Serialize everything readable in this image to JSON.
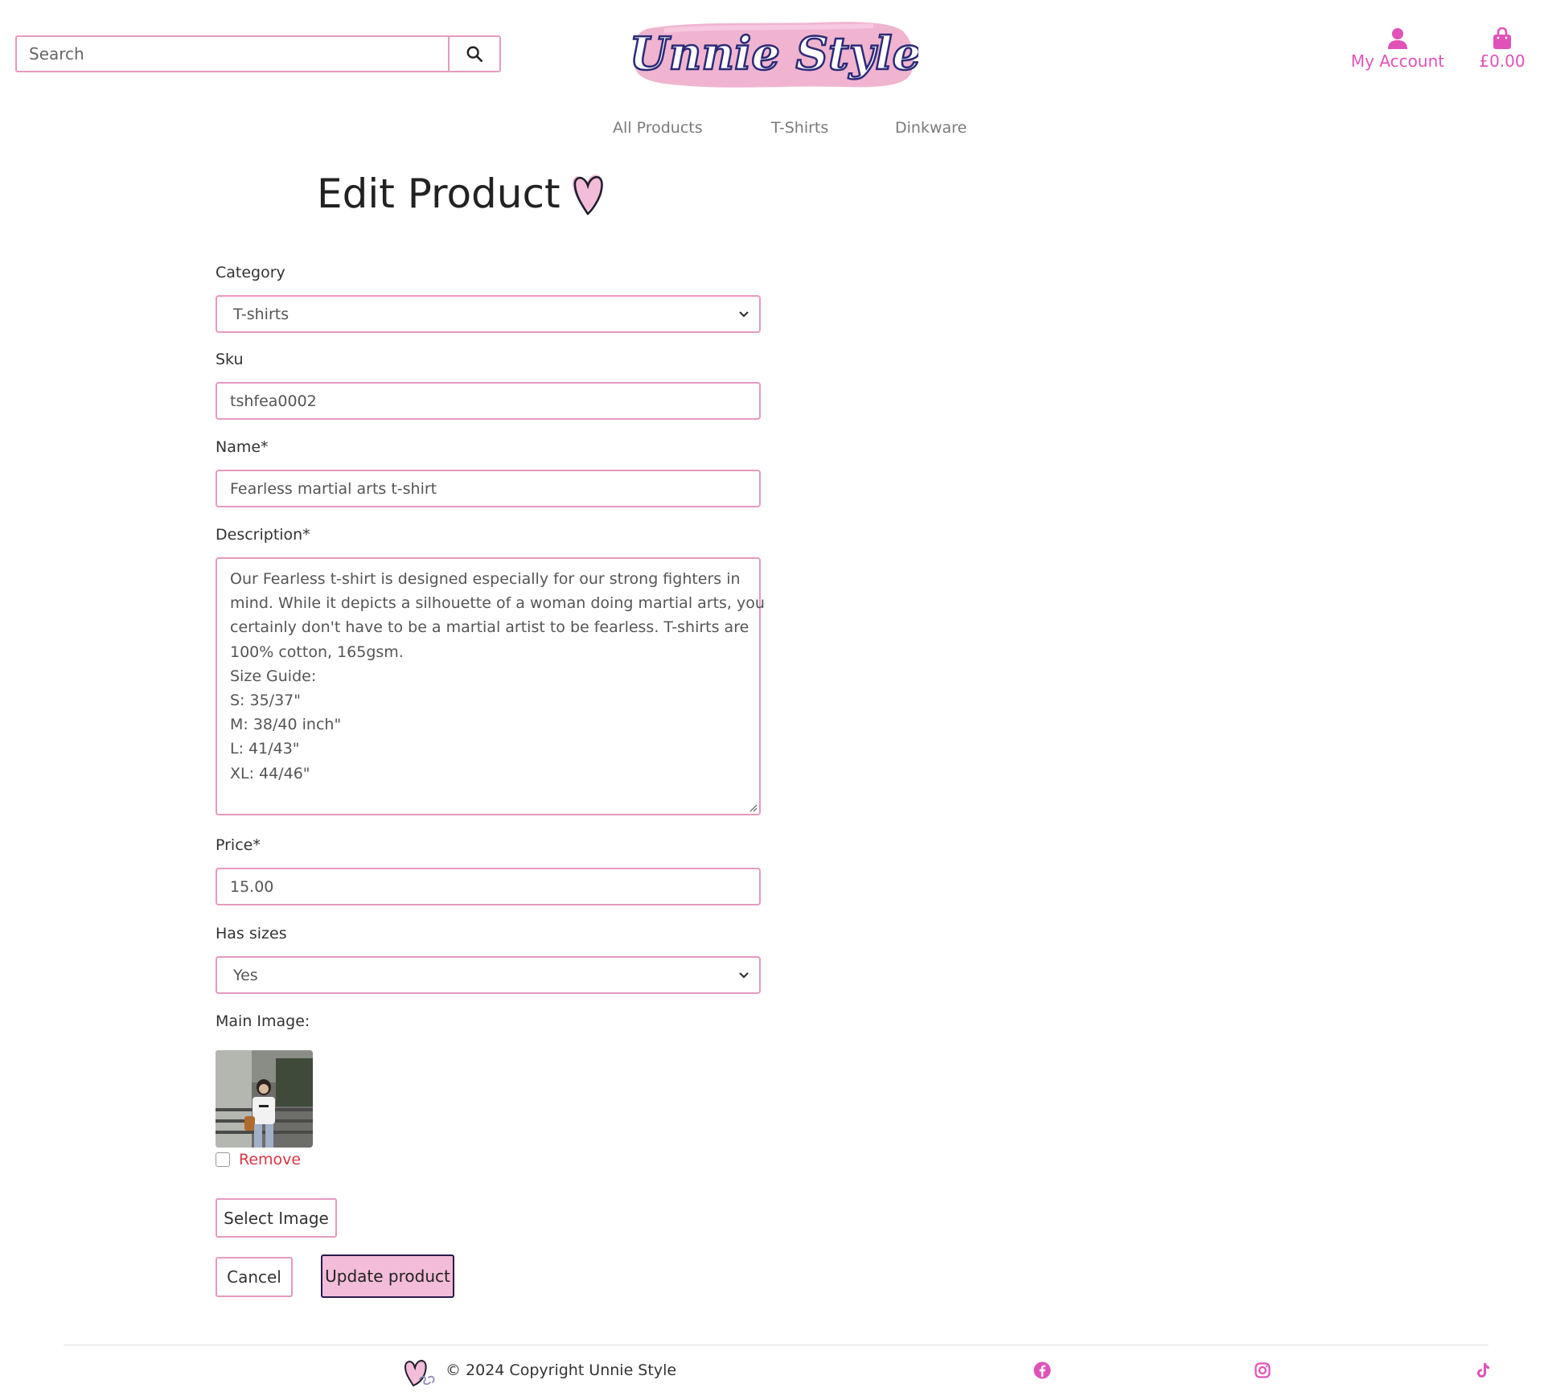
{
  "header": {
    "search": {
      "placeholder": "Search",
      "value": ""
    },
    "logo": {
      "text": "Unnie Style"
    },
    "account_label": "My Account",
    "cart_label": "£0.00"
  },
  "nav": {
    "items": [
      "All Products",
      "T-Shirts",
      "Dinkware"
    ]
  },
  "form": {
    "title": "Edit Product",
    "category": {
      "label": "Category",
      "value": "T-shirts"
    },
    "sku": {
      "label": "Sku",
      "value": "tshfea0002"
    },
    "name": {
      "label": "Name*",
      "value": "Fearless martial arts t-shirt"
    },
    "description": {
      "label": "Description*",
      "lines": [
        "Our Fearless t-shirt is designed especially for our strong fighters in",
        "mind. While it depicts a silhouette of a woman doing martial arts, you",
        "certainly don't have to be a martial artist to be fearless. T-shirts are",
        "100% cotton, 165gsm.",
        "Size Guide:",
        "S: 35/37\"",
        "M: 38/40 inch\"",
        "L: 41/43\"",
        "XL: 44/46\""
      ]
    },
    "price": {
      "label": "Price*",
      "value": "15.00"
    },
    "has_sizes": {
      "label": "Has sizes",
      "value": "Yes"
    },
    "main_image": {
      "label": "Main Image:",
      "remove_label": "Remove",
      "remove_checked": false
    },
    "select_image_label": "Select Image",
    "cancel_label": "Cancel",
    "update_label": "Update product"
  },
  "footer": {
    "copyright": "© 2024 Copyright Unnie Style"
  },
  "colors": {
    "accent": "#e052b8",
    "border": "#e59ac0",
    "danger": "#dc3545",
    "button_primary": "#f3bcd8",
    "logo_brush": "#f0b4d0",
    "logo_ink": "#2b2a78"
  },
  "icons": [
    "search-icon",
    "user-icon",
    "shopping-bag-icon",
    "heart-icon",
    "chevron-down-icon",
    "facebook-icon",
    "instagram-icon",
    "tiktok-icon"
  ]
}
